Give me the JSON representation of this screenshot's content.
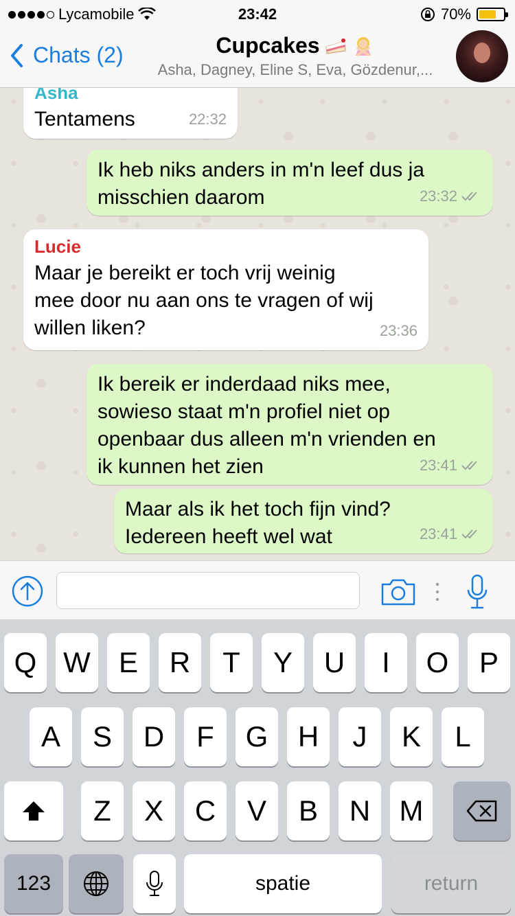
{
  "status_bar": {
    "carrier": "Lycamobile",
    "time": "23:42",
    "battery": "70%",
    "battery_level": 0.7
  },
  "nav": {
    "back_label": "Chats (2)",
    "title": "Cupcakes",
    "subtitle": "Asha, Dagney, Eline S, Eva, Gözdenur,..."
  },
  "messages": [
    {
      "direction": "in",
      "sender": "Asha",
      "sender_color": "#35b6c9",
      "text": "Tentamens",
      "time": "22:32"
    },
    {
      "direction": "out",
      "text": "Ik heb niks anders in m'n leef dus ja\nmisschien daarom",
      "time": "23:32",
      "read": true
    },
    {
      "direction": "in",
      "sender": "Lucie",
      "sender_color": "#d92b2b",
      "text": "Maar je bereikt er toch vrij weinig\nmee door nu aan ons te vragen of wij\nwillen liken?",
      "time": "23:36"
    },
    {
      "direction": "out",
      "text": "Ik bereik er inderdaad niks mee,\nsowieso staat m'n profiel niet op\nopenbaar dus alleen m'n vrienden en\nik kunnen het zien",
      "time": "23:41",
      "read": true
    },
    {
      "direction": "out",
      "text": "Maar als ik het toch fijn vind?\nIedereen heeft wel wat",
      "time": "23:41",
      "read": true
    }
  ],
  "input": {
    "value": "",
    "placeholder": ""
  },
  "keyboard": {
    "row1": [
      "Q",
      "W",
      "E",
      "R",
      "T",
      "Y",
      "U",
      "I",
      "O",
      "P"
    ],
    "row2": [
      "A",
      "S",
      "D",
      "F",
      "G",
      "H",
      "J",
      "K",
      "L"
    ],
    "row3": [
      "Z",
      "X",
      "C",
      "V",
      "B",
      "N",
      "M"
    ],
    "numbers_label": "123",
    "space_label": "spatie",
    "return_label": "return"
  },
  "colors": {
    "accent": "#1a7de0",
    "outgoing_bubble": "#dcf8c6",
    "incoming_bubble": "#ffffff",
    "battery": "#f4c20d"
  },
  "icons": [
    "wifi-icon",
    "lock-rotation-icon",
    "back-chevron-icon",
    "cake-emoji",
    "person-gesturing-no-emoji",
    "upload-icon",
    "camera-icon",
    "microphone-icon",
    "shift-icon",
    "delete-icon",
    "globe-icon",
    "dictation-icon",
    "double-check-icon"
  ]
}
